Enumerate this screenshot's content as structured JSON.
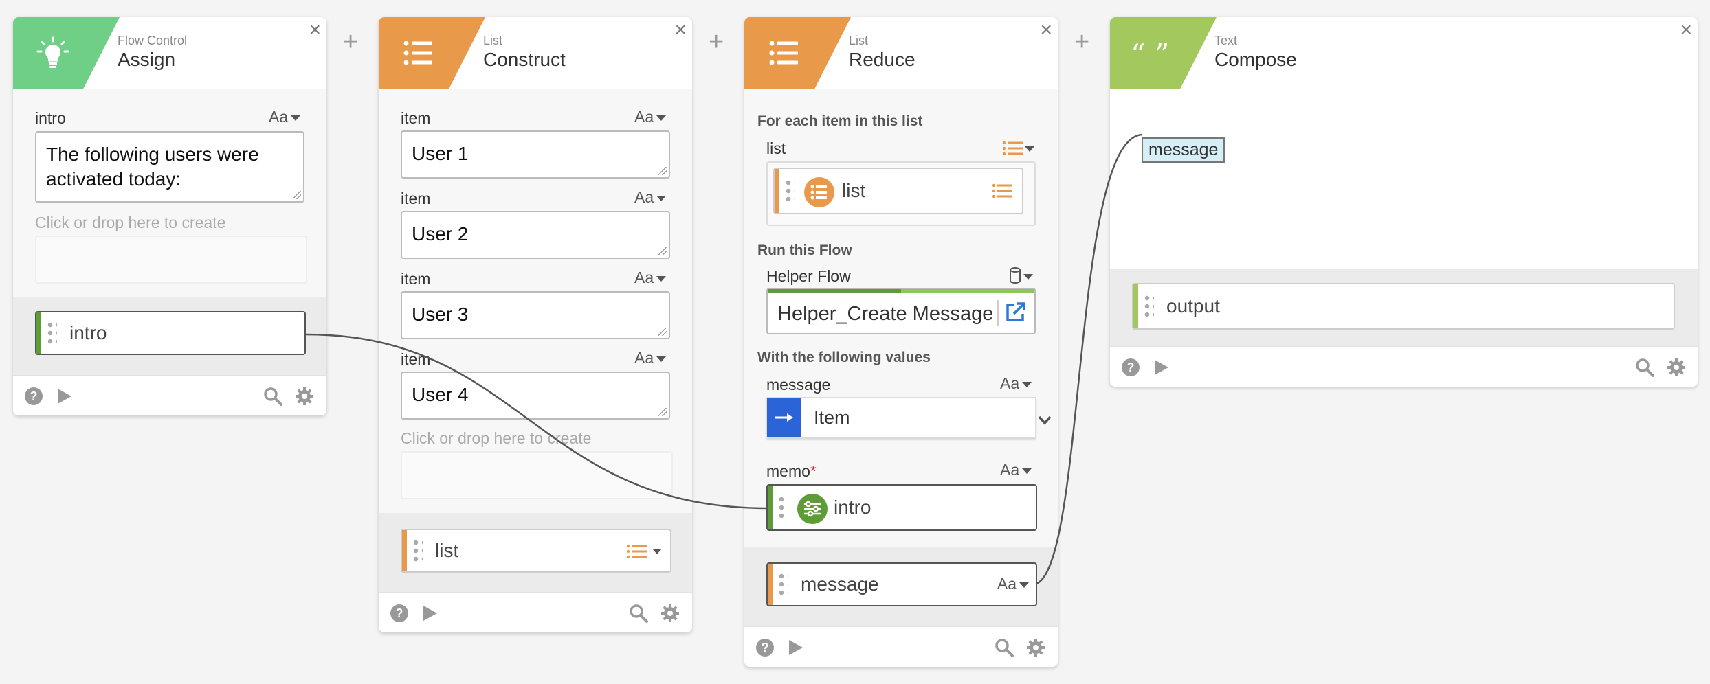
{
  "colors": {
    "flow_control": "#6fcf86",
    "list": "#e8994a",
    "text": "#a3c95e",
    "wire": "#555555",
    "item_blue": "#2a64d6",
    "intro_green": "#5e9c38"
  },
  "assign": {
    "category": "Flow Control",
    "title": "Assign",
    "icon": "lightbulb-icon",
    "field_label": "intro",
    "type_button": "Aa",
    "field_value_line1": "The following users were",
    "field_value_line2": "activated today:",
    "create_hint": "Click or drop here to create",
    "output_token": "intro"
  },
  "construct": {
    "category": "List",
    "title": "Construct",
    "icon": "list-icon",
    "items": [
      {
        "label": "item",
        "type_button": "Aa",
        "value": "User 1"
      },
      {
        "label": "item",
        "type_button": "Aa",
        "value": "User 2"
      },
      {
        "label": "item",
        "type_button": "Aa",
        "value": "User 3"
      },
      {
        "label": "item",
        "type_button": "Aa",
        "value": "User 4"
      }
    ],
    "create_hint": "Click or drop here to create",
    "output_token": "list"
  },
  "reduce": {
    "category": "List",
    "title": "Reduce",
    "icon": "list-icon",
    "section1": "For each item in this list",
    "list_label": "list",
    "list_token": "list",
    "section2": "Run this Flow",
    "helper_label": "Helper Flow",
    "helper_value": "Helper_Create Message",
    "section3": "With the following values",
    "message_label": "message",
    "message_type": "Aa",
    "item_value": "Item",
    "memo_label": "memo",
    "memo_required": "*",
    "memo_type": "Aa",
    "memo_token": "intro",
    "output_token": "message",
    "output_type": "Aa"
  },
  "compose": {
    "category": "Text",
    "title": "Compose",
    "icon": "quote-icon",
    "quote_glyph": "“ ”",
    "message_tag": "message",
    "output_token": "output"
  }
}
